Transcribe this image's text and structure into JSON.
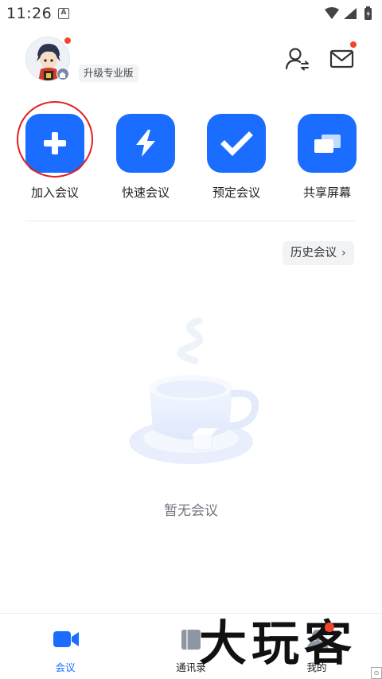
{
  "status_bar": {
    "time": "11:26",
    "indicator": "A",
    "icons": [
      "wifi-icon",
      "signal-icon",
      "battery-icon"
    ]
  },
  "header": {
    "upgrade_label": "升级专业版",
    "has_avatar_notification": true,
    "has_mail_notification": true
  },
  "actions": [
    {
      "label": "加入会议",
      "icon": "plus-icon"
    },
    {
      "label": "快速会议",
      "icon": "lightning-icon"
    },
    {
      "label": "预定会议",
      "icon": "checkmark-icon"
    },
    {
      "label": "共享屏幕",
      "icon": "screen-share-icon"
    }
  ],
  "history_button": {
    "label": "历史会议",
    "chevron": "›"
  },
  "empty_state": {
    "text": "暂无会议",
    "illustration": "coffee-cup-illustration"
  },
  "bottom_nav": [
    {
      "label": "会议",
      "icon": "video-camera-icon",
      "active": true
    },
    {
      "label": "通讯录",
      "icon": "address-book-icon",
      "active": false
    },
    {
      "label": "我的",
      "icon": "profile-icon",
      "active": false
    }
  ],
  "watermark": {
    "text": "大玩客"
  },
  "colors": {
    "accent": "#1a6dff",
    "notification": "#f0462e",
    "highlight_circle": "#e02020",
    "muted_text": "#707580"
  }
}
